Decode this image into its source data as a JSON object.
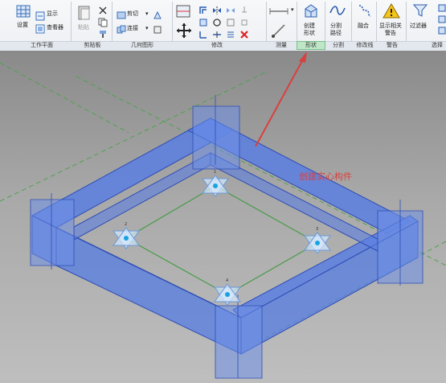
{
  "ribbon": {
    "groups": {
      "workplane": "工作平面",
      "clipboard": "剪贴板",
      "geometry": "几何图形",
      "modify": "修改",
      "measure": "测量",
      "create": "形状",
      "split": "分割",
      "modify_line": "修改线",
      "warning": "警告",
      "select": "选择"
    },
    "buttons": {
      "set": "设置",
      "show": "显示",
      "viewer": "查看器",
      "paste": "粘贴",
      "cut": "剪切",
      "join": "连接",
      "create_form": "创建\n形状",
      "split_path": "分割\n路径",
      "blend": "融合",
      "show_warnings": "显示相关\n警告",
      "filter": "过滤器"
    }
  },
  "annotation": {
    "text": "创建实心构件",
    "color": "#d94040"
  },
  "colors": {
    "beam_fill": "#5b7fe0",
    "beam_edge": "#2d4db4",
    "ref_line_green": "#3f9a3f",
    "ref_line_dash": "#4fa24f",
    "background": "#bdbdbd",
    "active_group": "#bfe6c7"
  },
  "points": [
    {
      "label": "1"
    },
    {
      "label": "2"
    },
    {
      "label": "3"
    },
    {
      "label": "4"
    }
  ]
}
